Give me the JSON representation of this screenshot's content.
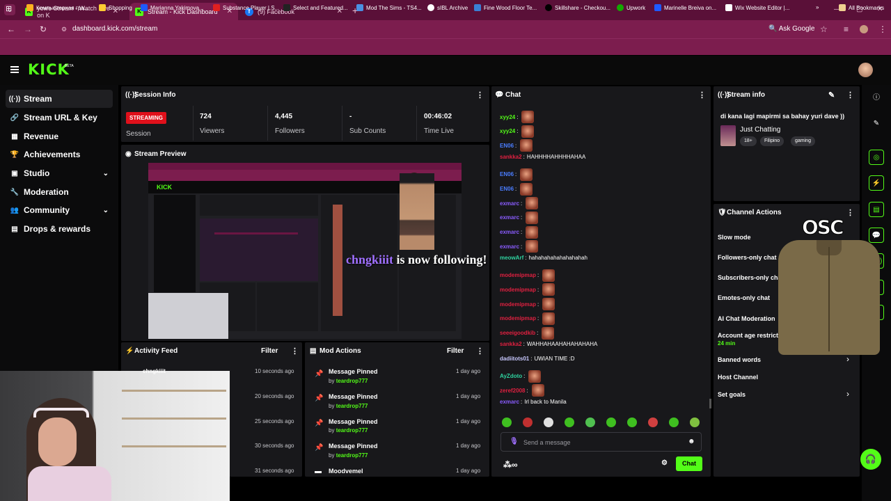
{
  "browser": {
    "tabs": [
      {
        "title": "yowe Stream - Watch Live on K",
        "favicon": "kick-icon"
      },
      {
        "title": "Stream - Kick Dashboard",
        "favicon": "kick-icon"
      },
      {
        "title": "(9) Facebook",
        "favicon": "facebook-icon"
      }
    ],
    "url": "dashboard.kick.com/stream",
    "ask_google": "Ask Google",
    "bookmarks": [
      "Компьютерная гра...",
      "Shopping",
      "Marianna Yakimova...",
      "Substance Player | S...",
      "Select and Featured...",
      "Mod The Sims - TS4...",
      "sIBL Archive",
      "Fine Wood Floor Te...",
      "Skillshare - Checkou...",
      "Upwork",
      "Marinelle Breiva on...",
      "Wix Website Editor |..."
    ],
    "all_bookmarks": "All Bookmarks"
  },
  "app": {
    "logo": "KICK",
    "beta": "BETA"
  },
  "sidebar": {
    "items": [
      {
        "label": "Stream",
        "icon": "stream-icon"
      },
      {
        "label": "Stream URL & Key",
        "icon": "link-icon"
      },
      {
        "label": "Revenue",
        "icon": "revenue-icon"
      },
      {
        "label": "Achievements",
        "icon": "trophy-icon"
      },
      {
        "label": "Studio",
        "icon": "studio-icon"
      },
      {
        "label": "Moderation",
        "icon": "wrench-icon"
      },
      {
        "label": "Community",
        "icon": "community-icon"
      },
      {
        "label": "Drops & rewards",
        "icon": "drops-icon"
      }
    ]
  },
  "session": {
    "title": "Session Info",
    "status": "STREAMING",
    "status_label": "Session",
    "viewers": "724",
    "viewers_label": "Viewers",
    "followers": "4,445",
    "followers_label": "Followers",
    "subs": "-",
    "subs_label": "Sub Counts",
    "time": "00:46:02",
    "time_label": "Time Live"
  },
  "preview": {
    "title": "Stream Preview",
    "follower_name": "chngkiiit",
    "follow_text": "is now following!"
  },
  "activity": {
    "title": "Activity Feed",
    "filter": "Filter",
    "first_user": "chngkiiit",
    "rows": [
      "10 seconds ago",
      "20 seconds ago",
      "25 seconds ago",
      "30 seconds ago",
      "31 seconds ago"
    ]
  },
  "mod_actions": {
    "title": "Mod Actions",
    "filter": "Filter",
    "rows": [
      {
        "action": "Message Pinned",
        "by": "by",
        "user": "teardrop777",
        "time": "1 day ago"
      },
      {
        "action": "Message Pinned",
        "by": "by",
        "user": "teardrop777",
        "time": "1 day ago"
      },
      {
        "action": "Message Pinned",
        "by": "by",
        "user": "teardrop777",
        "time": "1 day ago"
      },
      {
        "action": "Message Pinned",
        "by": "by",
        "user": "teardrop777",
        "time": "1 day ago"
      },
      {
        "action": "Moodvemel",
        "by": "",
        "user": "",
        "time": "1 day ago"
      }
    ]
  },
  "chat": {
    "title": "Chat",
    "messages": [
      {
        "user": "xyy24",
        "color": "#53fc18",
        "text": "",
        "emotes": 1
      },
      {
        "user": "xyy24",
        "color": "#53fc18",
        "text": "",
        "emotes": 1
      },
      {
        "user": "EN06",
        "color": "#4a7dff",
        "text": "",
        "emotes": 1
      },
      {
        "user": "sankka2",
        "color": "#e02040",
        "text": "HAHHHHAHHHHAHAA",
        "emotes": 0
      },
      {
        "user": "EN06",
        "color": "#4a7dff",
        "text": "",
        "emotes": 1
      },
      {
        "user": "EN06",
        "color": "#4a7dff",
        "text": "",
        "emotes": 1
      },
      {
        "user": "exmarc",
        "color": "#8a5cff",
        "text": "",
        "emotes": 1
      },
      {
        "user": "exmarc",
        "color": "#8a5cff",
        "text": "",
        "emotes": 1
      },
      {
        "user": "exmarc",
        "color": "#8a5cff",
        "text": "",
        "emotes": 1
      },
      {
        "user": "exmarc",
        "color": "#8a5cff",
        "text": "",
        "emotes": 1
      },
      {
        "user": "meowArf",
        "color": "#2fd3a0",
        "text": "hahahahahahahahahah",
        "emotes": 0
      },
      {
        "user": "modemipmap",
        "color": "#e02040",
        "text": "",
        "emotes": 1
      },
      {
        "user": "modemipmap",
        "color": "#e02040",
        "text": "",
        "emotes": 1
      },
      {
        "user": "modemipmap",
        "color": "#e02040",
        "text": "",
        "emotes": 1
      },
      {
        "user": "modemipmap",
        "color": "#e02040",
        "text": "",
        "emotes": 1
      },
      {
        "user": "seeeigoodkib",
        "color": "#e02040",
        "text": "",
        "emotes": 1
      },
      {
        "user": "sankka2",
        "color": "#e02040",
        "text": "WAHHAHAAHAHAHAHAHA",
        "emotes": 0
      },
      {
        "user": "dadiitots01",
        "color": "#c8c8ff",
        "text": "UWIAN TIME :D",
        "emotes": 0
      },
      {
        "user": "AyZdoto",
        "color": "#2fd3a0",
        "text": "",
        "emotes": 1
      },
      {
        "user": "zeref2008",
        "color": "#e02040",
        "text": "",
        "emotes": 1
      },
      {
        "user": "exmarc",
        "color": "#8a5cff",
        "text": "Irl back to Manila",
        "emotes": 0
      }
    ],
    "placeholder": "Send a message",
    "send_label": "Chat"
  },
  "stream_info": {
    "title": "Stream info",
    "stream_title": "di kana lagi mapirmi sa bahay yuri dave ))",
    "category": "Just Chatting",
    "tags": [
      "18+",
      "Filipino",
      "gaming"
    ]
  },
  "channel_actions": {
    "title": "Channel Actions",
    "items": [
      {
        "label": "Slow mode",
        "sub": ""
      },
      {
        "label": "Followers-only chat",
        "sub": ""
      },
      {
        "label": "Subscribers-only chat",
        "sub": ""
      },
      {
        "label": "Emotes-only chat",
        "sub": ""
      },
      {
        "label": "AI Chat Moderation",
        "sub": ""
      },
      {
        "label": "Account age restriction",
        "sub": "24 min"
      },
      {
        "label": "Banned words",
        "sub": ""
      },
      {
        "label": "Host Channel",
        "sub": ""
      },
      {
        "label": "Set goals",
        "sub": ""
      }
    ]
  },
  "overlay": {
    "logo_text": "OSC"
  },
  "colors": {
    "kick_green": "#53fc18",
    "live_red": "#e0101b",
    "browser_chrome": "#7c1d4e",
    "panel": "#18181b"
  }
}
